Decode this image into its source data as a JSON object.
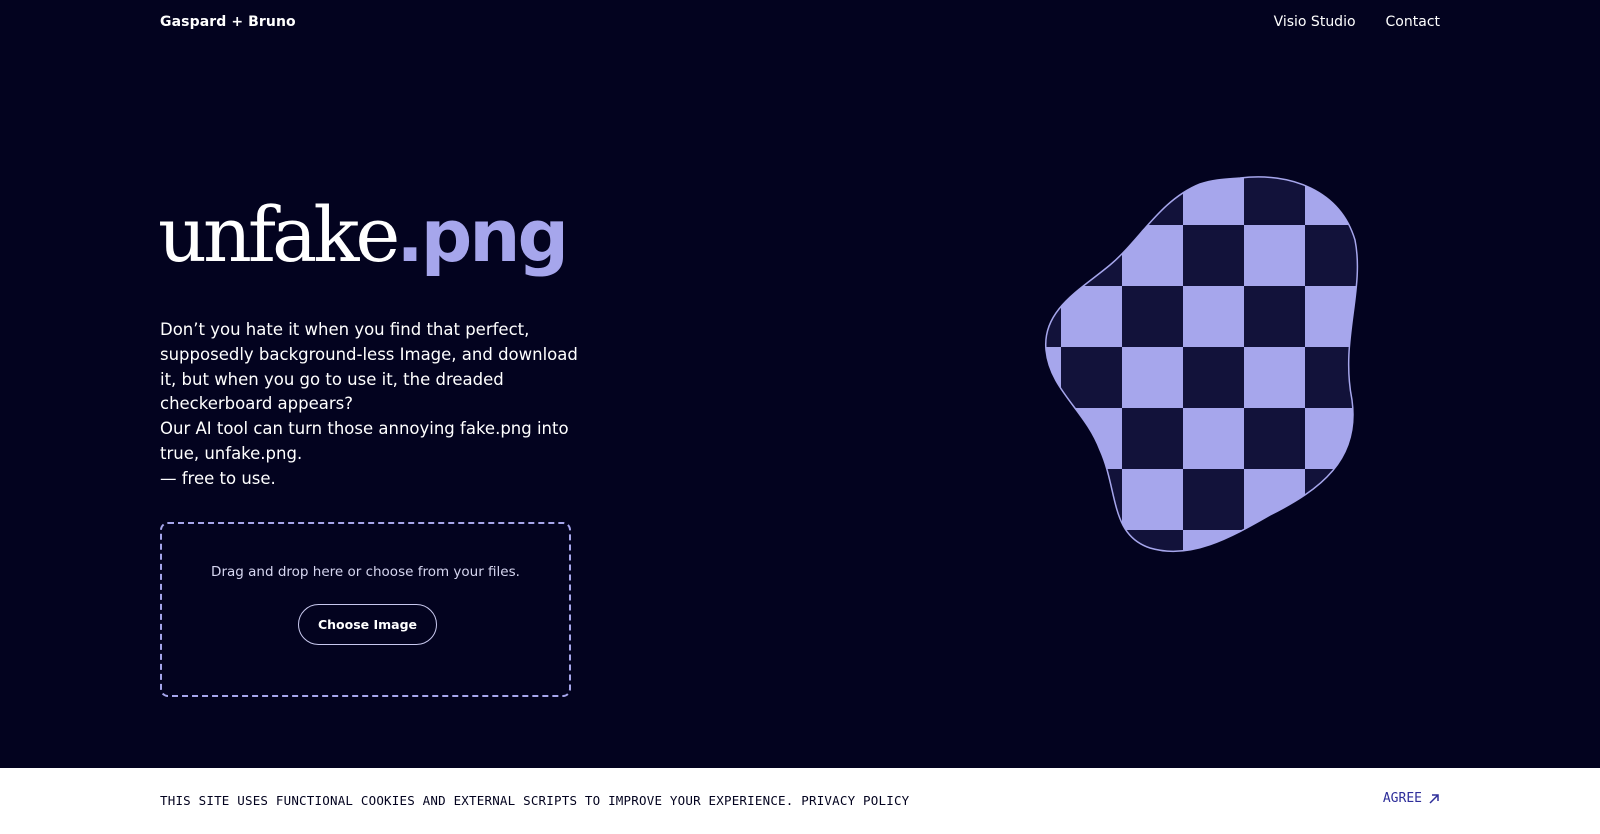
{
  "header": {
    "brand": "Gaspard + Bruno",
    "nav": [
      {
        "label": "Visio Studio"
      },
      {
        "label": "Contact"
      }
    ]
  },
  "hero": {
    "title_light": "unfake",
    "title_bold": ".png",
    "description": [
      "Don’t you hate it when you find that perfect, supposedly background-less Image, and download it, but when you go to use it, the dreaded checkerboard appears?",
      "Our AI tool can turn those annoying fake.png into true, unfake.png.",
      "— free to use."
    ]
  },
  "upload": {
    "prompt": "Drag and drop here or choose from your files.",
    "button_label": "Choose Image"
  },
  "cookie_bar": {
    "text": "THIS SITE USES FUNCTIONAL COOKIES AND EXTERNAL SCRIPTS TO IMPROVE YOUR EXPERIENCE.",
    "policy_link": "PRIVACY POLICY",
    "agree_label": "AGREE",
    "agree_icon": "arrow-up-right-icon"
  },
  "colors": {
    "background": "#03031f",
    "accent": "#a6a6ec",
    "checker_dark": "#12123a",
    "cookie_bg": "#ffffff"
  }
}
